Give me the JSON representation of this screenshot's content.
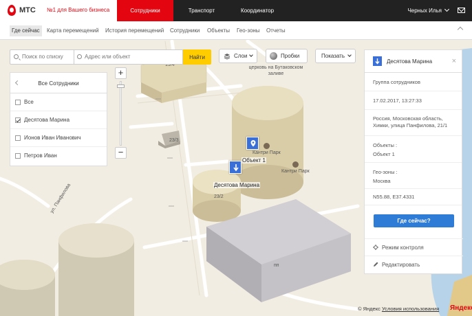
{
  "header": {
    "brand": "МТС",
    "tagline": "№1 для Вашего бизнеса",
    "nav": [
      {
        "label": "Сотрудники",
        "active": true
      },
      {
        "label": "Транспорт",
        "active": false
      },
      {
        "label": "Координатор",
        "active": false
      }
    ],
    "user": "Черных Илья",
    "brand_color": "#e30611"
  },
  "subnav": {
    "items": [
      {
        "label": "Где сейчас",
        "active": true
      },
      {
        "label": "Карта перемещений"
      },
      {
        "label": "История перемещений"
      },
      {
        "label": "Сотрудники"
      },
      {
        "label": "Объекты"
      },
      {
        "label": "Гео-зоны"
      },
      {
        "label": "Отчеты"
      }
    ]
  },
  "search": {
    "list_placeholder": "Поиск по списку",
    "address_placeholder": "Адрес или объект",
    "find_label": "Найти"
  },
  "map_controls": {
    "layers": "Слои",
    "traffic": "Пробки",
    "show": "Показать"
  },
  "employees_panel": {
    "title": "Все Сотрудники",
    "items": [
      {
        "label": "Все",
        "checked": false
      },
      {
        "label": "Десятова Марина",
        "checked": true
      },
      {
        "label": "Ионов Иван Иванович",
        "checked": false
      },
      {
        "label": "Петров Иван",
        "checked": false
      }
    ]
  },
  "map_labels": {
    "building_194": "19/4",
    "church": "церковь на Бутаковском заливе",
    "building_233": "23/3",
    "building_232": "23/2",
    "street": "ул. Панфилова",
    "building_pp": "пп",
    "object1": "Объект 1",
    "kantri_park_1": "Кантри Парк",
    "kantri_park_2": "Кантри Парк",
    "employee_marker": "Десятова Марина"
  },
  "detail_panel": {
    "name": "Десятова Марина",
    "group": "Группа сотрудников",
    "datetime": "17.02.2017, 13:27:33",
    "address": "Россия, Московская область, Химки, улица Панфилова, 21/1",
    "objects_label": "Объекты :",
    "objects_value": "Объект 1",
    "geozones_label": "Гео-зоны :",
    "geozones_value": "Москва",
    "coords": "N55.88, E37.4331",
    "where_button": "Где сейчас?",
    "control_mode": "Режим контроля",
    "edit": "Редактировать"
  },
  "footer": {
    "copyright": "© Яндекс",
    "terms": "Условия использования",
    "logo": "Яндекс"
  }
}
